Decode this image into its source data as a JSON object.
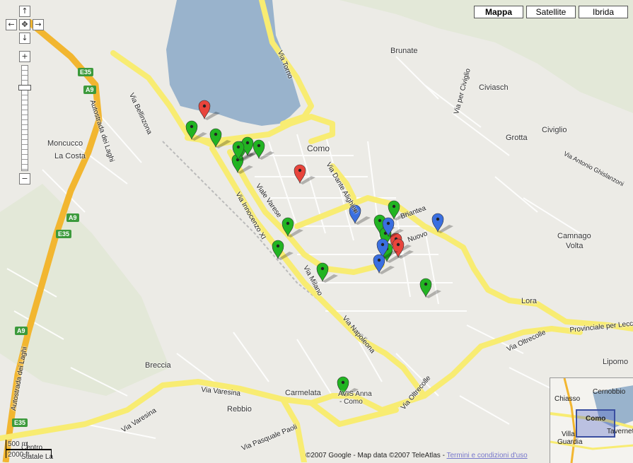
{
  "map_types": [
    {
      "label": "Mappa",
      "active": true
    },
    {
      "label": "Satellite",
      "active": false
    },
    {
      "label": "Ibrida",
      "active": false
    }
  ],
  "controls": {
    "pan_up": "↑",
    "pan_left": "←",
    "pan_center": "✥",
    "pan_right": "→",
    "pan_down": "↓",
    "zoom_in": "+",
    "zoom_out": "−"
  },
  "place_labels": {
    "brunate": "Brunate",
    "civiasch": "Civiasch",
    "grotta": "Grotta",
    "civiglio": "Civiglio",
    "moncucco": "Moncucco",
    "la_costa": "La Costa",
    "como": "Como",
    "camnago": "Camnago",
    "volta": "Volta",
    "lora": "Lora",
    "lipomo": "Lipomo",
    "breccia": "Breccia",
    "carmelata": "Carmelata",
    "rebbio": "Rebbio",
    "avis_anna": "AVIS Anna",
    "como_sub": "- Como"
  },
  "road_labels": {
    "via_bellinzona": "Via Bellinzona",
    "via_torno": "Via Torno",
    "via_per_civiglio": "Via per Civiglio",
    "via_antonio_ghislanzoni": "Via Antonio Ghislanzoni",
    "autostrada_dei_laghi_north": "Autostrada dei Laghi",
    "autostrada_dei_laghi_south": "Autostrada dei Laghi",
    "via_dante_alighieri": "Via Dante Alighieri",
    "viale_varese": "Viale Varese",
    "via_innocenzo_xi": "Via Innocenzo XI",
    "via_briantea": "Briantea",
    "via_nuovo": "Nuovo",
    "via_milano": "Via Milano",
    "via_napoleona": "Via Napoleona",
    "via_oltrecolle": "Via Oltrecolle",
    "provinciale_per_lecco": "Provinciale per Lecco",
    "via_varesina_north": "Via Varesina",
    "via_varesina_south": "Via Varesina",
    "via_pasquale_paoli": "Via Pasquale Paoli",
    "via_oltrecolle_south": "Via Oltrecolle",
    "statale_la": "Statale La",
    "centro": "Centro"
  },
  "shields": {
    "e35_top": "E35",
    "a9_top": "A9",
    "a9_mid": "A9",
    "e35_mid": "E35",
    "a9_bottom": "A9",
    "e35_bottom": "E35"
  },
  "shield_colors": {
    "e": "#3c9a3c",
    "a": "#3c9a3c"
  },
  "markers": [
    {
      "color": "green"
    },
    {
      "color": "green"
    },
    {
      "color": "green"
    },
    {
      "color": "green"
    },
    {
      "color": "green"
    },
    {
      "color": "green"
    },
    {
      "color": "green"
    },
    {
      "color": "green"
    },
    {
      "color": "green"
    },
    {
      "color": "green"
    },
    {
      "color": "green"
    },
    {
      "color": "green"
    },
    {
      "color": "green"
    },
    {
      "color": "green"
    },
    {
      "color": "green"
    },
    {
      "color": "green"
    },
    {
      "color": "red"
    },
    {
      "color": "red"
    },
    {
      "color": "red"
    },
    {
      "color": "red"
    },
    {
      "color": "blue"
    },
    {
      "color": "blue"
    },
    {
      "color": "blue"
    },
    {
      "color": "blue"
    },
    {
      "color": "blue"
    }
  ],
  "marker_colors": {
    "green": "#22b422",
    "red": "#e8453c",
    "blue": "#3a6fe0"
  },
  "scale": {
    "metric": "500 m",
    "imperial": "2000 ft"
  },
  "copyright": {
    "text": "©2007 Google - Map data ©2007 TeleAtlas - ",
    "link": "Termini e condizioni d'uso"
  },
  "overview": {
    "chiasso": "Chiasso",
    "cernobbio": "Cernobbio",
    "como": "Como",
    "villa_guardia_1": "Villa",
    "villa_guardia_2": "Guardia",
    "taverne": "Tavernet"
  },
  "colors": {
    "water": "#99b3cc",
    "road_major": "#f8ec72",
    "highway": "#f2b630",
    "land": "#ecebe6",
    "park": "#cfe0c3"
  }
}
